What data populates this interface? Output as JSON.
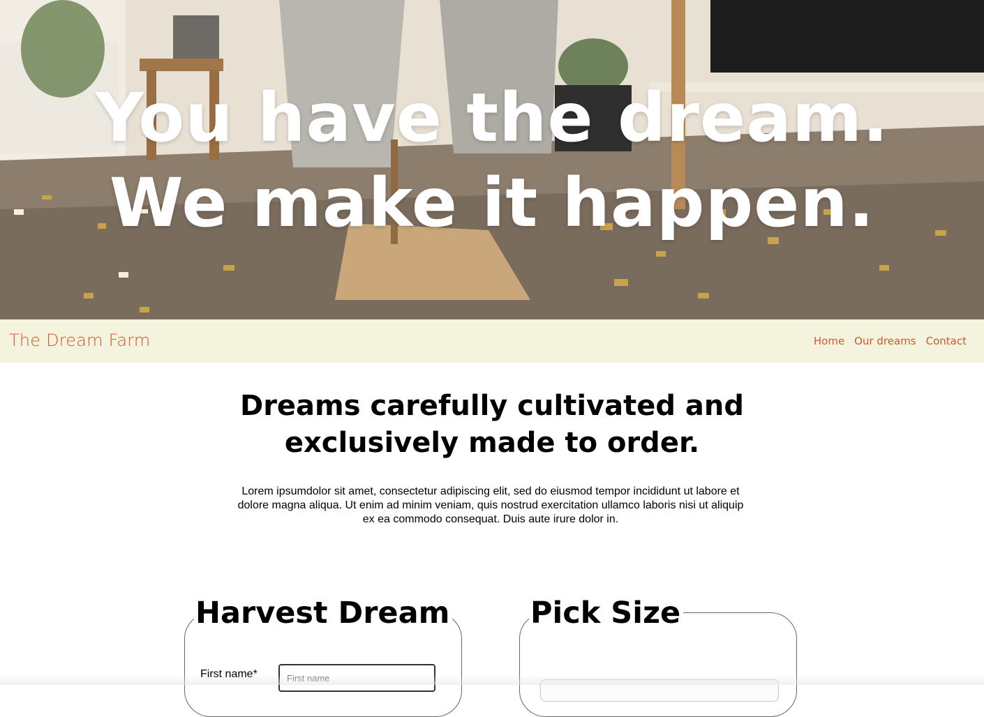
{
  "hero": {
    "line1": "You have the dream.",
    "line2": "We make it happen."
  },
  "navbar": {
    "brand": "The Dream Farm",
    "links": [
      {
        "label": "Home"
      },
      {
        "label": "Our dreams"
      },
      {
        "label": "Contact"
      }
    ]
  },
  "main": {
    "heading_line1": "Dreams carefully cultivated and",
    "heading_line2": "exclusively made to order.",
    "body": "Lorem ipsumdolor sit amet, consectetur adipiscing elit, sed do eiusmod tempor incididunt ut labore et dolore magna aliqua. Ut enim ad minim veniam, quis nostrud exercitation ullamco laboris nisi ut aliquip ex ea commodo consequat. Duis aute irure dolor in."
  },
  "harvest_form": {
    "legend": "Harvest Dream",
    "first_name_label": "First name*",
    "first_name_placeholder": "First name",
    "first_name_value": ""
  },
  "size_form": {
    "legend": "Pick Size"
  },
  "colors": {
    "accent": "#d0582f",
    "navbar_bg": "#f4f3dd"
  }
}
